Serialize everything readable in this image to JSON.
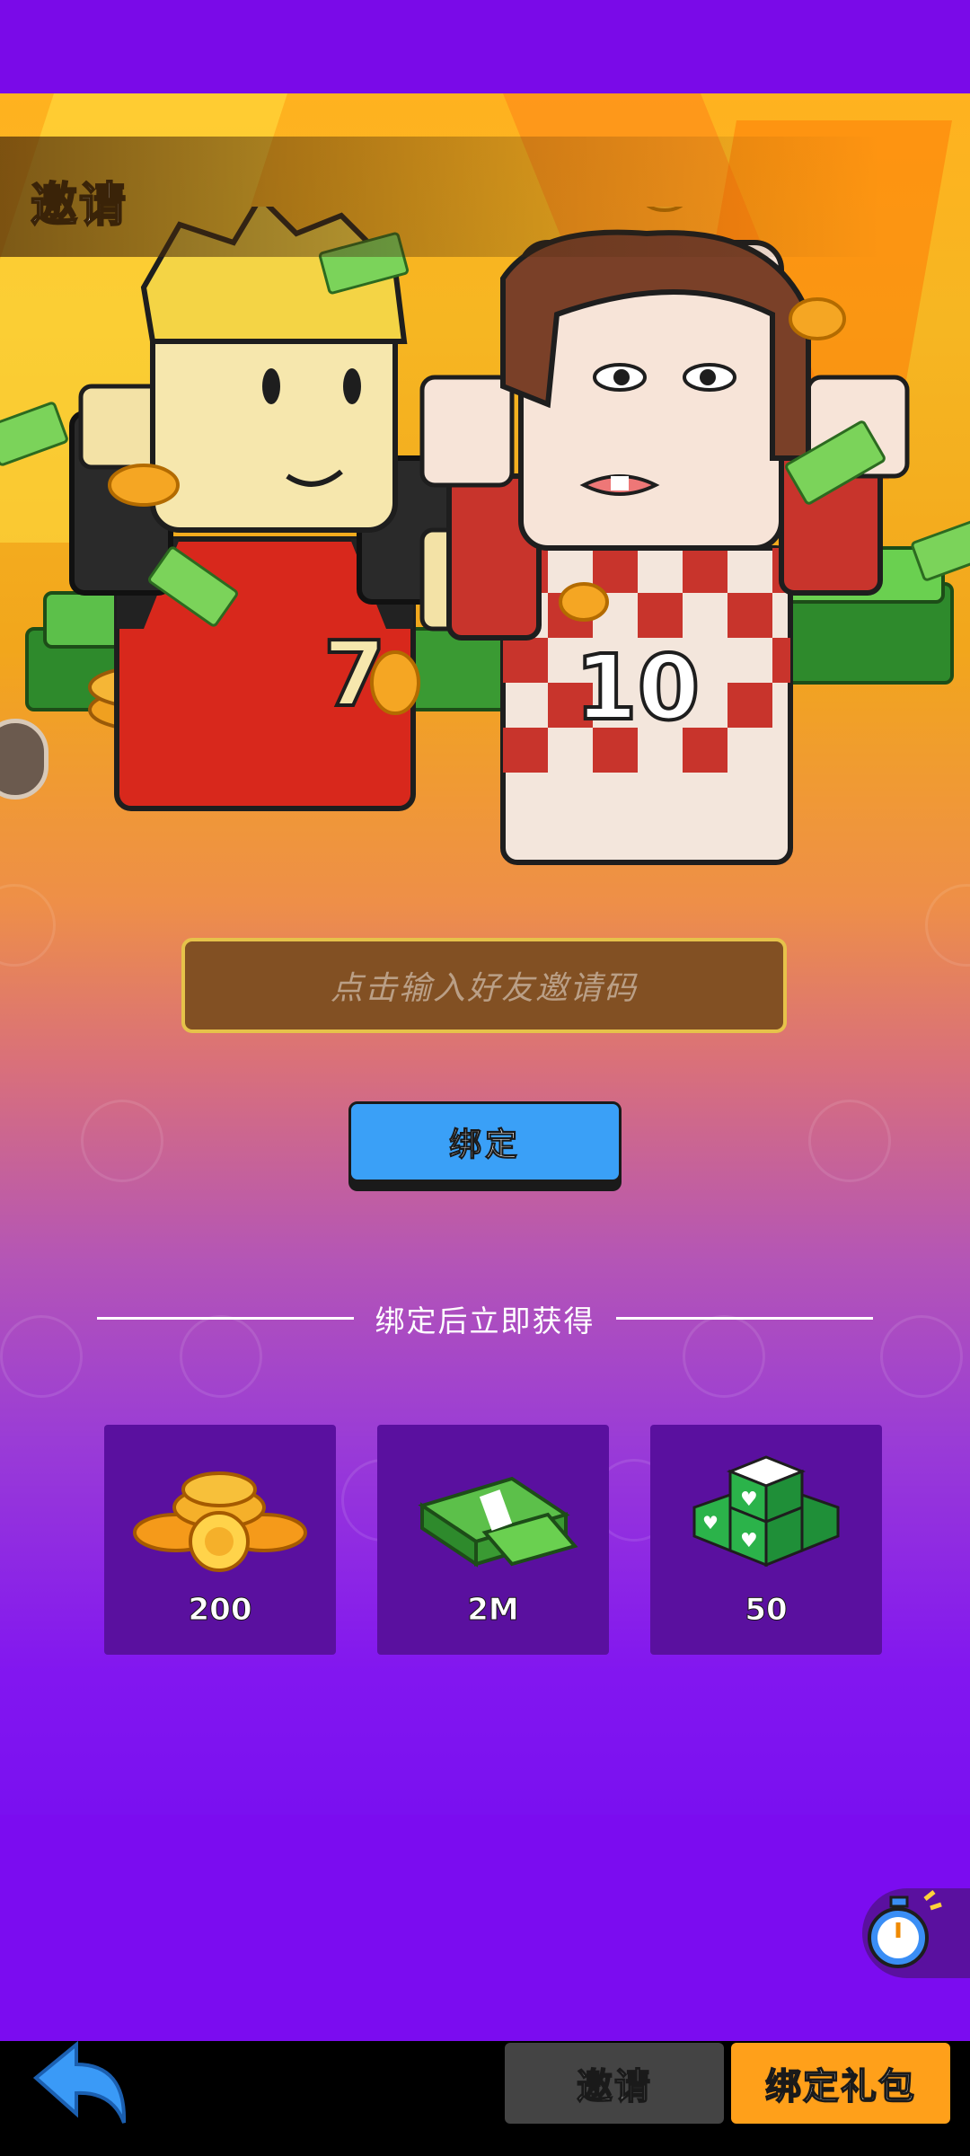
{
  "header": {
    "title": "邀请"
  },
  "invite": {
    "code_placeholder": "点击输入好友邀请码",
    "bind_label": "绑定",
    "rewards_caption": "绑定后立即获得"
  },
  "rewards": [
    {
      "icon": "gold-coins-icon",
      "value": "200"
    },
    {
      "icon": "cash-stack-icon",
      "value": "2M"
    },
    {
      "icon": "green-gem-cubes-icon",
      "value": "50"
    }
  ],
  "players": [
    {
      "shirt_number": "7",
      "shirt_color": "#d8281c"
    },
    {
      "shirt_number": "10",
      "shirt_color": "#c8342c"
    }
  ],
  "tabs": [
    {
      "label": "邀请",
      "active": false
    },
    {
      "label": "绑定礼包",
      "active": true
    }
  ],
  "colors": {
    "background": "#7b0cf0",
    "accent_blue": "#3aa0f7",
    "active_tab": "#ffa01a",
    "inactive_tab": "#444444"
  }
}
